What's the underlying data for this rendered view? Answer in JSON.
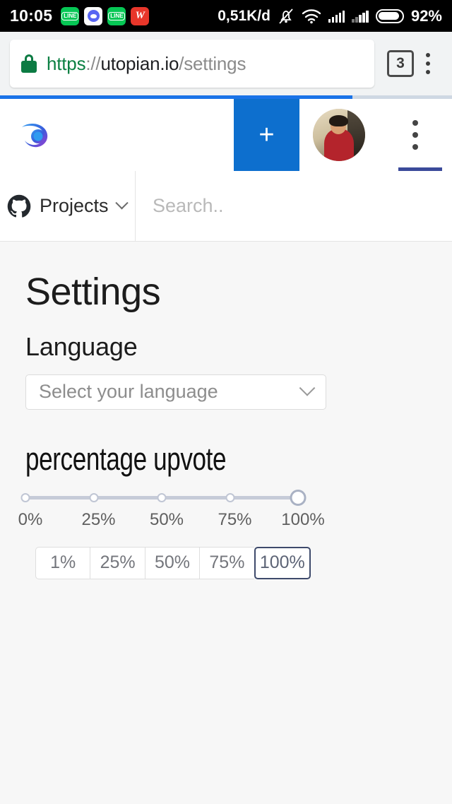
{
  "status_bar": {
    "clock": "10:05",
    "app_icons": [
      {
        "name": "line-icon",
        "label": "LINE"
      },
      {
        "name": "discord-icon",
        "label": ""
      },
      {
        "name": "line-icon",
        "label": "LINE"
      },
      {
        "name": "w-app-icon",
        "label": "W"
      }
    ],
    "data_speed": "0,51K/d",
    "notifications_muted": true,
    "wifi": "wifi-icon",
    "signal_1": "signal-full-icon",
    "signal_2": "signal-partial-icon",
    "battery_percent": "92%",
    "battery_level": 92
  },
  "browser": {
    "url_scheme": "https",
    "url_separator": "://",
    "url_host": "utopian.io",
    "url_path": "/settings",
    "lock_icon": "secure-lock-icon",
    "tab_count": "3",
    "menu_icon": "browser-menu-icon",
    "load_progress_percent": 78
  },
  "app_header": {
    "logo": "utopian-logo",
    "new_post_label": "+",
    "avatar": "user-avatar",
    "overflow_menu": "overflow-menu-icon"
  },
  "nav": {
    "projects_icon": "github-icon",
    "projects_label": "Projects",
    "projects_chevron": "chevron-down-icon",
    "search_placeholder": "Search.."
  },
  "page": {
    "title": "Settings",
    "language_label": "Language",
    "language_select_value": "Select your language",
    "language_select_chevron": "chevron-down-icon",
    "upvote_label": "percentage upvote"
  },
  "slider": {
    "tick_labels": [
      "0%",
      "25%",
      "50%",
      "75%",
      "100%"
    ],
    "tick_positions": [
      0,
      25,
      50,
      75,
      100
    ],
    "value": 100
  },
  "preset_buttons": {
    "options": [
      "1%",
      "25%",
      "50%",
      "75%",
      "100%"
    ],
    "selected": "100%"
  },
  "colors": {
    "accent_blue": "#0d6fce",
    "progress_blue": "#1a73e8",
    "secure_green": "#0c8043",
    "selected_border": "#3e4a6b",
    "page_bg": "#f7f7f7"
  }
}
